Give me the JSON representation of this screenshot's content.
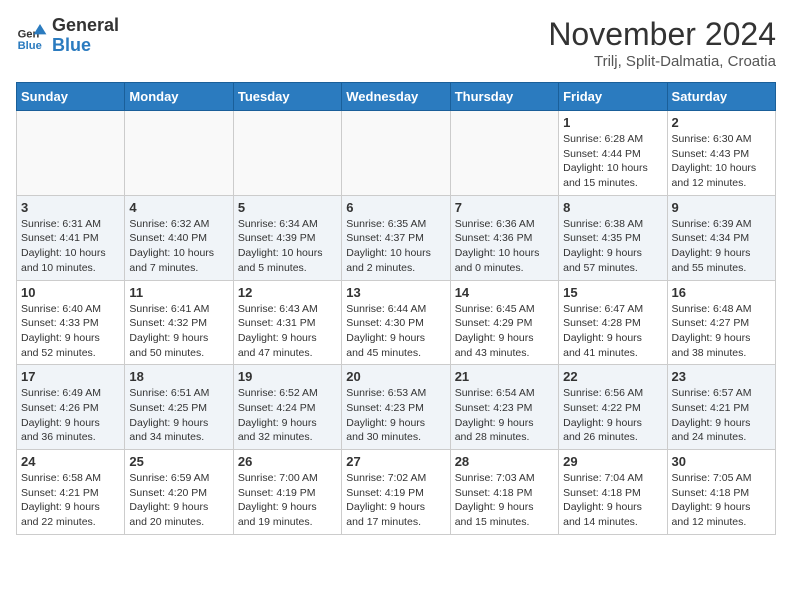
{
  "logo": {
    "general": "General",
    "blue": "Blue"
  },
  "title": {
    "month": "November 2024",
    "location": "Trilj, Split-Dalmatia, Croatia"
  },
  "days_of_week": [
    "Sunday",
    "Monday",
    "Tuesday",
    "Wednesday",
    "Thursday",
    "Friday",
    "Saturday"
  ],
  "weeks": [
    {
      "shaded": false,
      "days": [
        {
          "num": "",
          "info": ""
        },
        {
          "num": "",
          "info": ""
        },
        {
          "num": "",
          "info": ""
        },
        {
          "num": "",
          "info": ""
        },
        {
          "num": "",
          "info": ""
        },
        {
          "num": "1",
          "info": "Sunrise: 6:28 AM\nSunset: 4:44 PM\nDaylight: 10 hours\nand 15 minutes."
        },
        {
          "num": "2",
          "info": "Sunrise: 6:30 AM\nSunset: 4:43 PM\nDaylight: 10 hours\nand 12 minutes."
        }
      ]
    },
    {
      "shaded": true,
      "days": [
        {
          "num": "3",
          "info": "Sunrise: 6:31 AM\nSunset: 4:41 PM\nDaylight: 10 hours\nand 10 minutes."
        },
        {
          "num": "4",
          "info": "Sunrise: 6:32 AM\nSunset: 4:40 PM\nDaylight: 10 hours\nand 7 minutes."
        },
        {
          "num": "5",
          "info": "Sunrise: 6:34 AM\nSunset: 4:39 PM\nDaylight: 10 hours\nand 5 minutes."
        },
        {
          "num": "6",
          "info": "Sunrise: 6:35 AM\nSunset: 4:37 PM\nDaylight: 10 hours\nand 2 minutes."
        },
        {
          "num": "7",
          "info": "Sunrise: 6:36 AM\nSunset: 4:36 PM\nDaylight: 10 hours\nand 0 minutes."
        },
        {
          "num": "8",
          "info": "Sunrise: 6:38 AM\nSunset: 4:35 PM\nDaylight: 9 hours\nand 57 minutes."
        },
        {
          "num": "9",
          "info": "Sunrise: 6:39 AM\nSunset: 4:34 PM\nDaylight: 9 hours\nand 55 minutes."
        }
      ]
    },
    {
      "shaded": false,
      "days": [
        {
          "num": "10",
          "info": "Sunrise: 6:40 AM\nSunset: 4:33 PM\nDaylight: 9 hours\nand 52 minutes."
        },
        {
          "num": "11",
          "info": "Sunrise: 6:41 AM\nSunset: 4:32 PM\nDaylight: 9 hours\nand 50 minutes."
        },
        {
          "num": "12",
          "info": "Sunrise: 6:43 AM\nSunset: 4:31 PM\nDaylight: 9 hours\nand 47 minutes."
        },
        {
          "num": "13",
          "info": "Sunrise: 6:44 AM\nSunset: 4:30 PM\nDaylight: 9 hours\nand 45 minutes."
        },
        {
          "num": "14",
          "info": "Sunrise: 6:45 AM\nSunset: 4:29 PM\nDaylight: 9 hours\nand 43 minutes."
        },
        {
          "num": "15",
          "info": "Sunrise: 6:47 AM\nSunset: 4:28 PM\nDaylight: 9 hours\nand 41 minutes."
        },
        {
          "num": "16",
          "info": "Sunrise: 6:48 AM\nSunset: 4:27 PM\nDaylight: 9 hours\nand 38 minutes."
        }
      ]
    },
    {
      "shaded": true,
      "days": [
        {
          "num": "17",
          "info": "Sunrise: 6:49 AM\nSunset: 4:26 PM\nDaylight: 9 hours\nand 36 minutes."
        },
        {
          "num": "18",
          "info": "Sunrise: 6:51 AM\nSunset: 4:25 PM\nDaylight: 9 hours\nand 34 minutes."
        },
        {
          "num": "19",
          "info": "Sunrise: 6:52 AM\nSunset: 4:24 PM\nDaylight: 9 hours\nand 32 minutes."
        },
        {
          "num": "20",
          "info": "Sunrise: 6:53 AM\nSunset: 4:23 PM\nDaylight: 9 hours\nand 30 minutes."
        },
        {
          "num": "21",
          "info": "Sunrise: 6:54 AM\nSunset: 4:23 PM\nDaylight: 9 hours\nand 28 minutes."
        },
        {
          "num": "22",
          "info": "Sunrise: 6:56 AM\nSunset: 4:22 PM\nDaylight: 9 hours\nand 26 minutes."
        },
        {
          "num": "23",
          "info": "Sunrise: 6:57 AM\nSunset: 4:21 PM\nDaylight: 9 hours\nand 24 minutes."
        }
      ]
    },
    {
      "shaded": false,
      "days": [
        {
          "num": "24",
          "info": "Sunrise: 6:58 AM\nSunset: 4:21 PM\nDaylight: 9 hours\nand 22 minutes."
        },
        {
          "num": "25",
          "info": "Sunrise: 6:59 AM\nSunset: 4:20 PM\nDaylight: 9 hours\nand 20 minutes."
        },
        {
          "num": "26",
          "info": "Sunrise: 7:00 AM\nSunset: 4:19 PM\nDaylight: 9 hours\nand 19 minutes."
        },
        {
          "num": "27",
          "info": "Sunrise: 7:02 AM\nSunset: 4:19 PM\nDaylight: 9 hours\nand 17 minutes."
        },
        {
          "num": "28",
          "info": "Sunrise: 7:03 AM\nSunset: 4:18 PM\nDaylight: 9 hours\nand 15 minutes."
        },
        {
          "num": "29",
          "info": "Sunrise: 7:04 AM\nSunset: 4:18 PM\nDaylight: 9 hours\nand 14 minutes."
        },
        {
          "num": "30",
          "info": "Sunrise: 7:05 AM\nSunset: 4:18 PM\nDaylight: 9 hours\nand 12 minutes."
        }
      ]
    }
  ]
}
